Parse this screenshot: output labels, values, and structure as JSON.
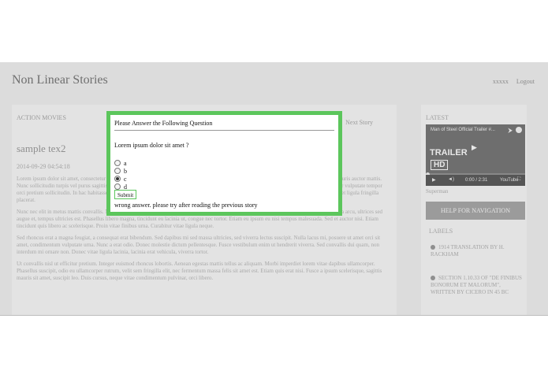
{
  "site": {
    "title": "Non Linear Stories",
    "user_link": "xxxxx",
    "logout": "Logout"
  },
  "main": {
    "section_label": "ACTION MOVIES",
    "next_story": "Next Story",
    "post_title": "sample tex2",
    "post_date": "2014-09-29 04:54:18",
    "paragraphs": [
      "Lorem ipsum dolor sit amet, consectetur adipiscing elit. Aliquam nec tortor ac dolor pellentesque ultricies non a lectus. Sed auctor augue auctor mauris auctor mattis. Nunc sollicitudin turpis vel purus sagittis, quis dapibus ligula fermentum. Nulla commodo sapien et nibh tempus, a dictum nisi dignissim. Curabitur vulputate tempor orci pretium sollicitudin. In hac habitasse platea dictumst. Suspendisse eget metus vitae est molestie suscipit. Sed at mi leo. Praesent vitae ligula eget ligula fringilla placerat.",
      "Nunc nec elit in metus mattis convallis. Nunc lacinia, odio id congue sollicitudin, mi nibh molestie sapien, et maximus nibh nisl in nisi. Donec nulla arcu, ultrices sed augue et, tempus ultricies est. Phasellus libero magna, tincidunt eu lacinia ut, congue nec tortor. Etiam eu ipsum eu nisi tempus malesuada. Sed et auctor nisi. Etiam tincidunt quis libero ac scelerisque. Proin vitae finibus urna. Curabitur vitae ligula neque.",
      "Sed rhoncus erat a magna feugiat, a consequat erat bibendum. Sed dapibus mi sed massa ultricies, sed viverra lectus suscipit. Nulla lacus mi, posuere ut amet orci sit amet, condimentum vulputate urna. Nunc a erat odio. Donec molestie dictum pellentesque. Fusce vestibulum enim ut hendrerit viverra. Sed convallis dui quam, non interdum mi ornare non. Donec vitae ligula lacinia, lacinia erat vehicula, viverra tortor.",
      "Ut convallis nisl ut efficitur pretium. Integer euismod rhoncus lobortis. Aenean egestas mattis tellus ac aliquam. Morbi imperdiet lorem vitae dapibus ullamcorper. Phasellus suscipit, odio eu ullamcorper rutrum, velit sem fringilla elit, nec fermentum massa felis sit amet est. Etiam quis erat nisi. Fusce a ipsum scelerisque, sagittis mauris sit amet, suscipit leo. Duis cursus, neque vitae condimentum pulvinar, orci libero."
    ]
  },
  "sidebar": {
    "latest_label": "LATEST",
    "video_title": "Man of Steel Official Trailer #...",
    "video_trailer": "TRAILER",
    "video_hd": "HD",
    "video_time": "0:00 / 2:31",
    "video_brand": "YouTube",
    "video_caption": "Superman",
    "help_button": "HELP FOR NAVIGATION",
    "labels_label": "LABELS",
    "labels": [
      "1914 TRANSLATION BY H. RACKHAM",
      "SECTION 1.10.33 OF \"DE FINIBUS BONORUM ET MALORUM\", WRITTEN BY CICERO IN 45 BC"
    ]
  },
  "dialog": {
    "heading": "Please Answer the Following Question",
    "question": "Lorem ipsum dolor sit amet ?",
    "options": [
      "a",
      "b",
      "c",
      "d"
    ],
    "selected_option": "c",
    "submit_label": "Submit",
    "result_text": "wrong answer. please try after reading the previous story",
    "border_color": "#5cc65c"
  }
}
